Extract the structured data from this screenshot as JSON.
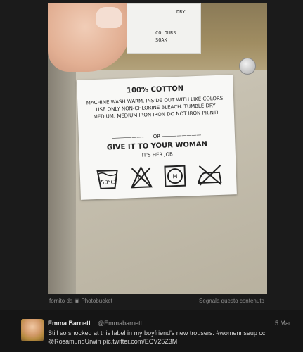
{
  "photo": {
    "tag_top_lines": [
      "DRY",
      "COLOURS",
      "SOAK"
    ],
    "label": {
      "title": "100% COTTON",
      "care_text": "MACHINE WASH WARM. INSIDE OUT WITH LIKE COLORS. USE ONLY NON-CHLORINE BLEACH. TUMBLE DRY MEDIUM. MEDIUM IRON IRON DO NOT IRON PRINT!",
      "or": "OR",
      "give_line": "GIVE IT TO YOUR WOMAN",
      "signature": "IT'S HER JOB",
      "icons": [
        "wash-50c-icon",
        "no-chlorine-bleach-icon",
        "tumble-dry-medium-icon",
        "do-not-iron-icon"
      ],
      "wash_temp": "50°C",
      "bleach_mark": "CL",
      "dryer_mark": "M"
    }
  },
  "source_bar": {
    "left_text": "fornito da",
    "provider": "Photobucket",
    "right_text": "Segnala questo contenuto"
  },
  "tweet": {
    "author_name": "Emma Barnett",
    "handle": "@Emmabarnett",
    "date": "5 Mar",
    "text_line1": "Still so shocked at this label in my boyfriend's new trousers.",
    "hashtag": "#womenriseup",
    "cc": "cc",
    "mention": "@RosamundUrwin",
    "link": "pic.twitter.com/ECV25Z3M"
  },
  "colors": {
    "background": "#1b1b1b",
    "tweet_bg": "#151515",
    "label": "#f8f8f6"
  }
}
